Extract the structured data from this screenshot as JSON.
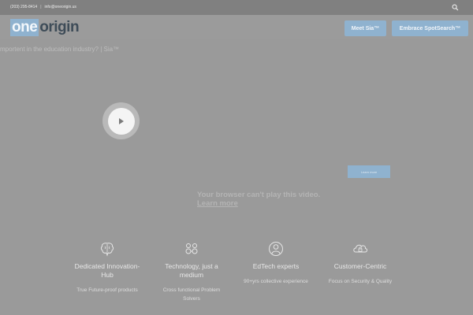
{
  "topbar": {
    "phone": "(203) 295-8414",
    "separator": "|",
    "email": "info@oneorigin.us"
  },
  "logo": {
    "part1": "one",
    "part2": "origin"
  },
  "nav": {
    "meet_sia": "Meet Sia™",
    "embrace_spotsearch": "Embrace SpotSearch™"
  },
  "ticker": {
    "text": "mportent in the education industry? | Sia™"
  },
  "video": {
    "learn_btn": "Learn more",
    "error_text": "Your browser can't play this video.",
    "error_link": "Learn more"
  },
  "features": [
    {
      "icon": "brain-icon",
      "title": "Dedicated Innovation-Hub",
      "subtitle": "True Future-proof products"
    },
    {
      "icon": "team-icon",
      "title": "Technology, just a medium",
      "subtitle": "Cross functional Problem Solvers"
    },
    {
      "icon": "expert-icon",
      "title": "EdTech experts",
      "subtitle": "90+yrs collective experience"
    },
    {
      "icon": "cloud-lock-icon",
      "title": "Customer-Centric",
      "subtitle": "Focus on Security & Quality"
    }
  ],
  "colors": {
    "accent": "#8fb2cf",
    "overlay": "#9a9a9a",
    "topbar": "#808080"
  }
}
